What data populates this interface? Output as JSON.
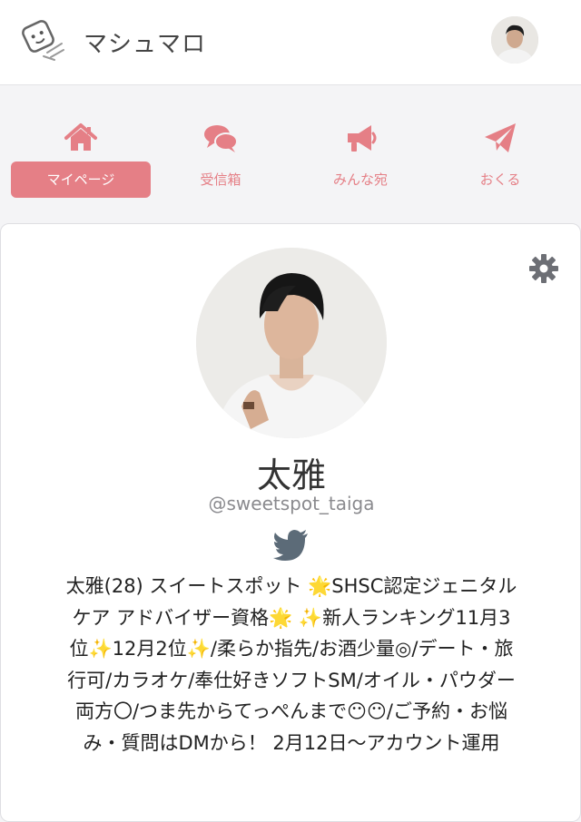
{
  "header": {
    "title": "マシュマロ",
    "logo_icon": "marshmallow-logo-icon",
    "avatar_icon": "user-avatar"
  },
  "nav": {
    "items": [
      {
        "label": "マイページ",
        "icon": "home-icon",
        "active": true
      },
      {
        "label": "受信箱",
        "icon": "chat-bubbles-icon",
        "active": false
      },
      {
        "label": "みんな宛",
        "icon": "megaphone-icon",
        "active": false
      },
      {
        "label": "おくる",
        "icon": "paper-plane-icon",
        "active": false
      }
    ]
  },
  "profile": {
    "name": "太雅",
    "handle": "@sweetspot_taiga",
    "bio": "太雅(28) スイートスポット 🌟SHSC認定ジェニタルケア アドバイザー資格🌟 ✨新人ランキング11月3位✨12月2位✨/柔らか指先/お酒少量◎/デート・旅行可/カラオケ/奉仕好きソフトSM/オイル・パウダー両方〇/つま先からてっぺんまで😶😶/ご予約・お悩み・質問はDMから！ 2月12日〜アカウント運用"
  },
  "colors": {
    "accent": "#e57f86",
    "twitter": "#5c6b78",
    "gear": "#6d6f75"
  }
}
